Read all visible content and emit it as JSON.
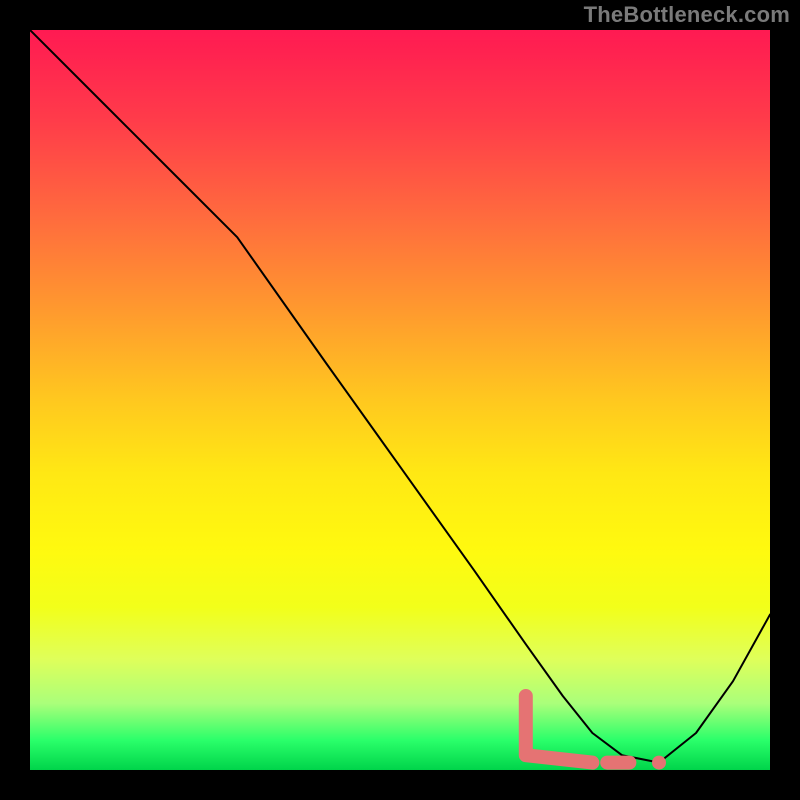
{
  "watermark": "TheBottleneck.com",
  "chart_data": {
    "type": "line",
    "title": "",
    "xlabel": "",
    "ylabel": "",
    "xlim": [
      0,
      100
    ],
    "ylim": [
      0,
      100
    ],
    "background_gradient": {
      "direction": "vertical",
      "stops": [
        {
          "pos": 0,
          "color": "#ff1a52"
        },
        {
          "pos": 25,
          "color": "#ff6a3e"
        },
        {
          "pos": 50,
          "color": "#ffc81f"
        },
        {
          "pos": 70,
          "color": "#fff90f"
        },
        {
          "pos": 90,
          "color": "#aaff7a"
        },
        {
          "pos": 100,
          "color": "#00d44a"
        }
      ]
    },
    "series": [
      {
        "name": "bottleneck-curve",
        "color": "#000000",
        "x": [
          0,
          10,
          20,
          28,
          40,
          50,
          60,
          67,
          72,
          76,
          80,
          85,
          90,
          95,
          100
        ],
        "y": [
          100,
          90,
          80,
          72,
          55,
          41,
          27,
          17,
          10,
          5,
          2,
          1,
          5,
          12,
          21
        ]
      }
    ],
    "markers": {
      "name": "optimal-range",
      "color": "#e57373",
      "segments": [
        {
          "x": [
            67,
            67,
            76
          ],
          "y": [
            10,
            2,
            1
          ]
        },
        {
          "x": [
            78,
            81
          ],
          "y": [
            1,
            1
          ]
        }
      ],
      "points": [
        {
          "x": 85,
          "y": 1
        }
      ]
    }
  }
}
